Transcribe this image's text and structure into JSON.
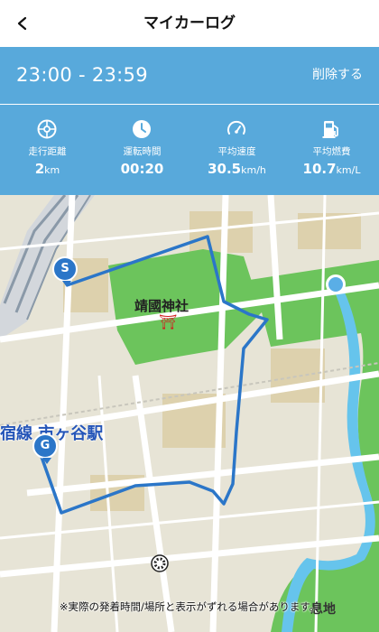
{
  "header": {
    "title": "マイカーログ",
    "back_icon": "chevron-left-icon"
  },
  "log": {
    "time_range": "23:00 - 23:59",
    "delete_label": "削除する"
  },
  "stats": [
    {
      "icon": "wheel-icon",
      "label": "走行距離",
      "value": "2",
      "unit": "km"
    },
    {
      "icon": "clock-icon",
      "label": "運転時間",
      "value": "00:20",
      "unit": ""
    },
    {
      "icon": "speedometer-icon",
      "label": "平均速度",
      "value": "30.5",
      "unit": "km/h"
    },
    {
      "icon": "fuel-pump-icon",
      "label": "平均燃費",
      "value": "10.7",
      "unit": "km/L"
    }
  ],
  "map": {
    "shrine_name": "靖國神社",
    "torii_symbol": "⛩",
    "station_name": "宿線 市ヶ谷駅",
    "pond_label": "息地",
    "start_marker": "S",
    "goal_marker": "G",
    "disclaimer": "※実際の発着時間/場所と表示がずれる場合があります。",
    "colors": {
      "route": "#2b76c8",
      "park": "#6cc45c",
      "header": "#58a9db",
      "water": "#66c4ec"
    }
  }
}
